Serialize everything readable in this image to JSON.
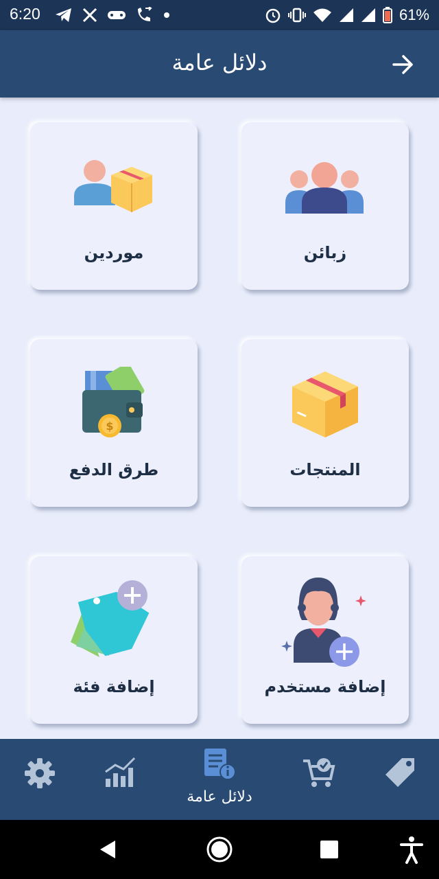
{
  "status_bar": {
    "time": "6:20",
    "battery": "61%",
    "left_icons": [
      "telegram-icon",
      "x-icon",
      "voicemail-icon",
      "call-forward-icon",
      "dot-icon"
    ],
    "right_icons": [
      "alarm-icon",
      "vibrate-icon",
      "wifi-icon",
      "signal-icon",
      "signal-icon",
      "battery-icon"
    ]
  },
  "app_bar": {
    "title": "دلائل عامة",
    "back_icon": "arrow-right-icon"
  },
  "cards": {
    "customers": {
      "label": "زبائن",
      "icon": "customers-group-icon"
    },
    "suppliers": {
      "label": "موردين",
      "icon": "supplier-box-icon"
    },
    "products": {
      "label": "المنتجات",
      "icon": "product-box-icon"
    },
    "payment_methods": {
      "label": "طرق الدفع",
      "icon": "wallet-icon"
    },
    "add_user": {
      "label": "إضافة مستخدم",
      "icon": "add-user-icon"
    },
    "add_category": {
      "label": "إضافة فئة",
      "icon": "add-category-tag-icon"
    }
  },
  "bottom_nav": {
    "items": [
      {
        "icon": "tag-icon"
      },
      {
        "icon": "cart-check-icon"
      },
      {
        "icon": "directory-book-icon",
        "label": "دلائل عامة"
      },
      {
        "icon": "chart-icon"
      },
      {
        "icon": "gear-icon"
      }
    ]
  },
  "colors": {
    "status_bar": "#1c3556",
    "app_bar": "#284a73",
    "background": "#e9edfb",
    "card": "#edf0fc",
    "nav_icon": "#b4c4d8"
  }
}
